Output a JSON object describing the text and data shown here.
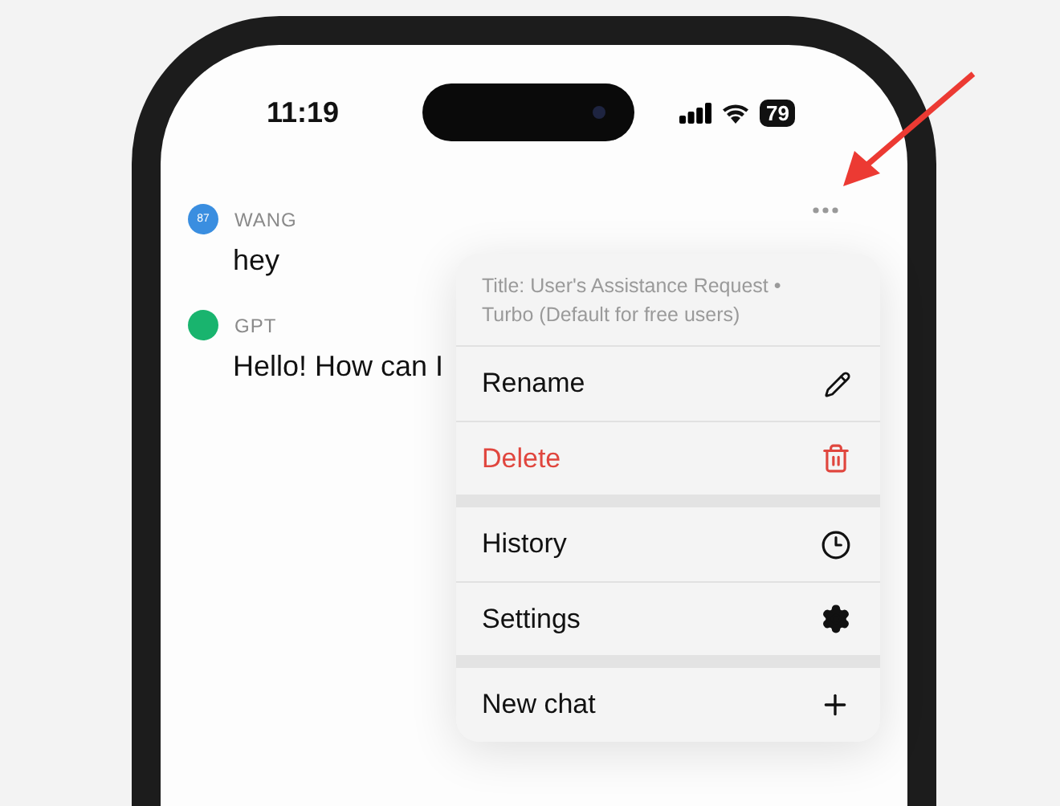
{
  "status_bar": {
    "time": "11:19",
    "battery": "79"
  },
  "messages": [
    {
      "author": "WANG",
      "avatar": "87",
      "kind": "user",
      "text": "hey"
    },
    {
      "author": "GPT",
      "kind": "bot",
      "text": "Hello! How can I"
    }
  ],
  "menu": {
    "title": "Title: User's Assistance Request • Turbo (Default for free users)",
    "groups": [
      [
        {
          "label": "Rename",
          "destructive": false
        },
        {
          "label": "Delete",
          "destructive": true
        }
      ],
      [
        {
          "label": "History",
          "destructive": false
        },
        {
          "label": "Settings",
          "destructive": false
        }
      ],
      [
        {
          "label": "New chat",
          "destructive": false
        }
      ]
    ]
  }
}
